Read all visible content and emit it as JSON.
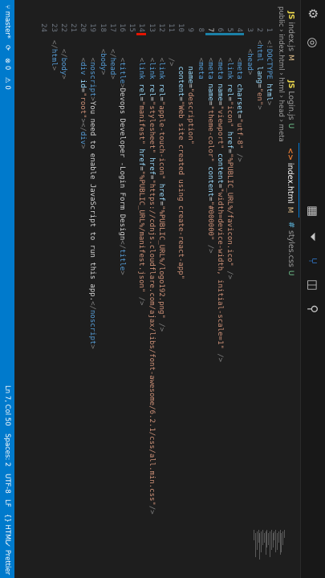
{
  "tabs": [
    {
      "icon": "JS",
      "name": "index.js",
      "mod": "M",
      "color": "#e8d44d"
    },
    {
      "icon": "JS",
      "name": "Login.js",
      "mod": "U",
      "color": "#e8d44d"
    },
    {
      "icon": "<>",
      "name": "index.html",
      "mod": "M",
      "color": "#e37933"
    },
    {
      "icon": "#",
      "name": "styles.css",
      "mod": "U",
      "color": "#519aba"
    }
  ],
  "breadcrumb": [
    "public",
    "index.html",
    "html",
    "head",
    "meta"
  ],
  "code_lines": [
    {
      "n": "1",
      "html": "<span class=\"pun\">&lt;!</span><span class=\"doc\">DOCTYPE</span> <span class=\"att\">html</span><span class=\"pun\">&gt;</span>"
    },
    {
      "n": "2",
      "html": "<span class=\"pun\">&lt;</span><span class=\"tag\">html</span> <span class=\"att\">lang</span><span class=\"txt\">=</span><span class=\"str\">\"en\"</span><span class=\"pun\">&gt;</span>"
    },
    {
      "n": "3",
      "html": "  <span class=\"pun\">&lt;</span><span class=\"tag\">head</span><span class=\"pun\">&gt;</span>"
    },
    {
      "n": "4",
      "html": "    <span class=\"pun\">&lt;</span><span class=\"tag\">meta</span> <span class=\"att\">charset</span><span class=\"txt\">=</span><span class=\"str\">\"utf-8\"</span> <span class=\"pun\">/&gt;</span>"
    },
    {
      "n": "5",
      "html": "    <span class=\"pun\">&lt;</span><span class=\"tag\">link</span> <span class=\"att\">rel</span><span class=\"txt\">=</span><span class=\"str\">\"icon\"</span> <span class=\"att\">href</span><span class=\"txt\">=</span><span class=\"str\">\"%PUBLIC_URL%/favicon.ico\"</span> <span class=\"pun\">/&gt;</span>"
    },
    {
      "n": "6",
      "html": "    <span class=\"pun\">&lt;</span><span class=\"tag\">meta</span> <span class=\"att\">name</span><span class=\"txt\">=</span><span class=\"str\">\"viewport\"</span> <span class=\"att\">content</span><span class=\"txt\">=</span><span class=\"str\">\"width=device-width, initial-scale=1\"</span> <span class=\"pun\">/&gt;</span>"
    },
    {
      "n": "7",
      "html": "    <span class=\"pun\">&lt;</span><span class=\"tag\">meta</span> <span class=\"att\">name</span><span class=\"txt\">=</span><span class=\"str\">\"theme-color\"</span> <span class=\"att\">content</span><span class=\"txt\">=</span><span class=\"str\">\"#000000\"</span> <span class=\"pun\">/&gt;</span>"
    },
    {
      "n": "8",
      "html": "    <span class=\"pun\">&lt;</span><span class=\"tag\">meta</span>"
    },
    {
      "n": "9",
      "html": "      <span class=\"att\">name</span><span class=\"txt\">=</span><span class=\"str\">\"description\"</span>"
    },
    {
      "n": "10",
      "html": "      <span class=\"att\">content</span><span class=\"txt\">=</span><span class=\"str\">\"Web site created using create-react-app\"</span>"
    },
    {
      "n": "11",
      "html": "    <span class=\"pun\">/&gt;</span>"
    },
    {
      "n": "12",
      "html": "    <span class=\"pun\">&lt;</span><span class=\"tag\">link</span> <span class=\"att\">rel</span><span class=\"txt\">=</span><span class=\"str\">\"apple-touch-icon\"</span> <span class=\"att\">href</span><span class=\"txt\">=</span><span class=\"str\">\"%PUBLIC_URL%/logo192.png\"</span> <span class=\"pun\">/&gt;</span>"
    },
    {
      "n": "13",
      "html": "    <span class=\"pun\">&lt;</span><span class=\"tag\">link</span> <span class=\"att\">rel</span><span class=\"txt\">=</span><span class=\"str\">\"stylesheet\"</span> <span class=\"att\">href</span><span class=\"txt\">=</span><span class=\"str\">\"https://cdnjs.cloudflare.com/ajax/libs/font-awesome/6.2.1/css/all.min.css\"</span><span class=\"pun\">/&gt;</span>"
    },
    {
      "n": "14",
      "html": "    <span class=\"pun\">&lt;</span><span class=\"tag\">link</span> <span class=\"att\">rel</span><span class=\"txt\">=</span><span class=\"str\">\"manifest\"</span> <span class=\"att\">href</span><span class=\"txt\">=</span><span class=\"str\">\"%PUBLIC_URL%/manifest.json\"</span> <span class=\"pun\">/&gt;</span>"
    },
    {
      "n": "15",
      "html": ""
    },
    {
      "n": "16",
      "html": "    <span class=\"pun\">&lt;</span><span class=\"tag\">title</span><span class=\"pun\">&gt;</span><span class=\"txt\">Devops Developer -Login Form Design</span><span class=\"pun\">&lt;/</span><span class=\"tag\">title</span><span class=\"pun\">&gt;</span>"
    },
    {
      "n": "17",
      "html": "  <span class=\"pun\">&lt;/</span><span class=\"tag\">head</span><span class=\"pun\">&gt;</span>"
    },
    {
      "n": "18",
      "html": "  <span class=\"pun\">&lt;</span><span class=\"tag\">body</span><span class=\"pun\">&gt;</span>"
    },
    {
      "n": "19",
      "html": "    <span class=\"pun\">&lt;</span><span class=\"tag\">noscript</span><span class=\"pun\">&gt;</span><span class=\"txt\">You need to enable JavaScript to run this app.</span><span class=\"pun\">&lt;/</span><span class=\"tag\">noscript</span><span class=\"pun\">&gt;</span>"
    },
    {
      "n": "20",
      "html": "    <span class=\"pun\">&lt;</span><span class=\"tag\">div</span> <span class=\"att\">id</span><span class=\"txt\">=</span><span class=\"str\">\"root\"</span><span class=\"pun\">&gt;&lt;/</span><span class=\"tag\">div</span><span class=\"pun\">&gt;</span>"
    },
    {
      "n": "21",
      "html": ""
    },
    {
      "n": "22",
      "html": "  <span class=\"pun\">&lt;/</span><span class=\"tag\">body</span><span class=\"pun\">&gt;</span>"
    },
    {
      "n": "23",
      "html": "<span class=\"pun\">&lt;/</span><span class=\"tag\">html</span><span class=\"pun\">&gt;</span>"
    },
    {
      "n": "24",
      "html": ""
    }
  ],
  "status": {
    "branch": "master*",
    "sync": "⟳",
    "errors": "⊗ 0",
    "warnings": "⚠ 0",
    "position": "Ln 7, Col 50",
    "spaces": "Spaces: 2",
    "encoding": "UTF-8",
    "eol": "LF",
    "language": "{} HTML",
    "prettier": "✓ Prettier"
  },
  "colors": {
    "accent": "#007acc",
    "tab_active_border": "#0078d4"
  }
}
